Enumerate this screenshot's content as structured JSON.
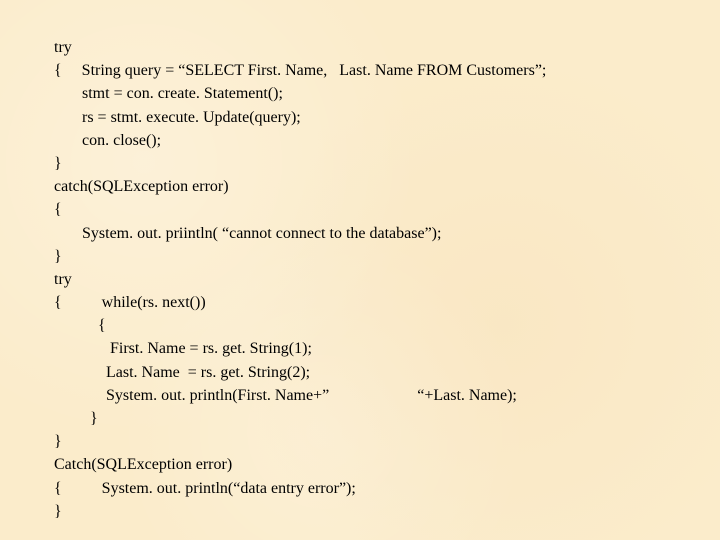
{
  "code": {
    "lines": [
      "try",
      "{     String query = “SELECT First. Name,   Last. Name FROM Customers”;",
      "       stmt = con. create. Statement();",
      "       rs = stmt. execute. Update(query);",
      "       con. close();",
      "}",
      "catch(SQLException error)",
      "{",
      "       System. out. priintln( “cannot connect to the database”);",
      "}",
      "try",
      "{          while(rs. next())",
      "           {",
      "              First. Name = rs. get. String(1);",
      "             Last. Name  = rs. get. String(2);",
      "             System. out. println(First. Name+”                      “+Last. Name);",
      "         }",
      "}",
      "Catch(SQLException error)",
      "{          System. out. println(“data entry error”);",
      "}"
    ]
  }
}
